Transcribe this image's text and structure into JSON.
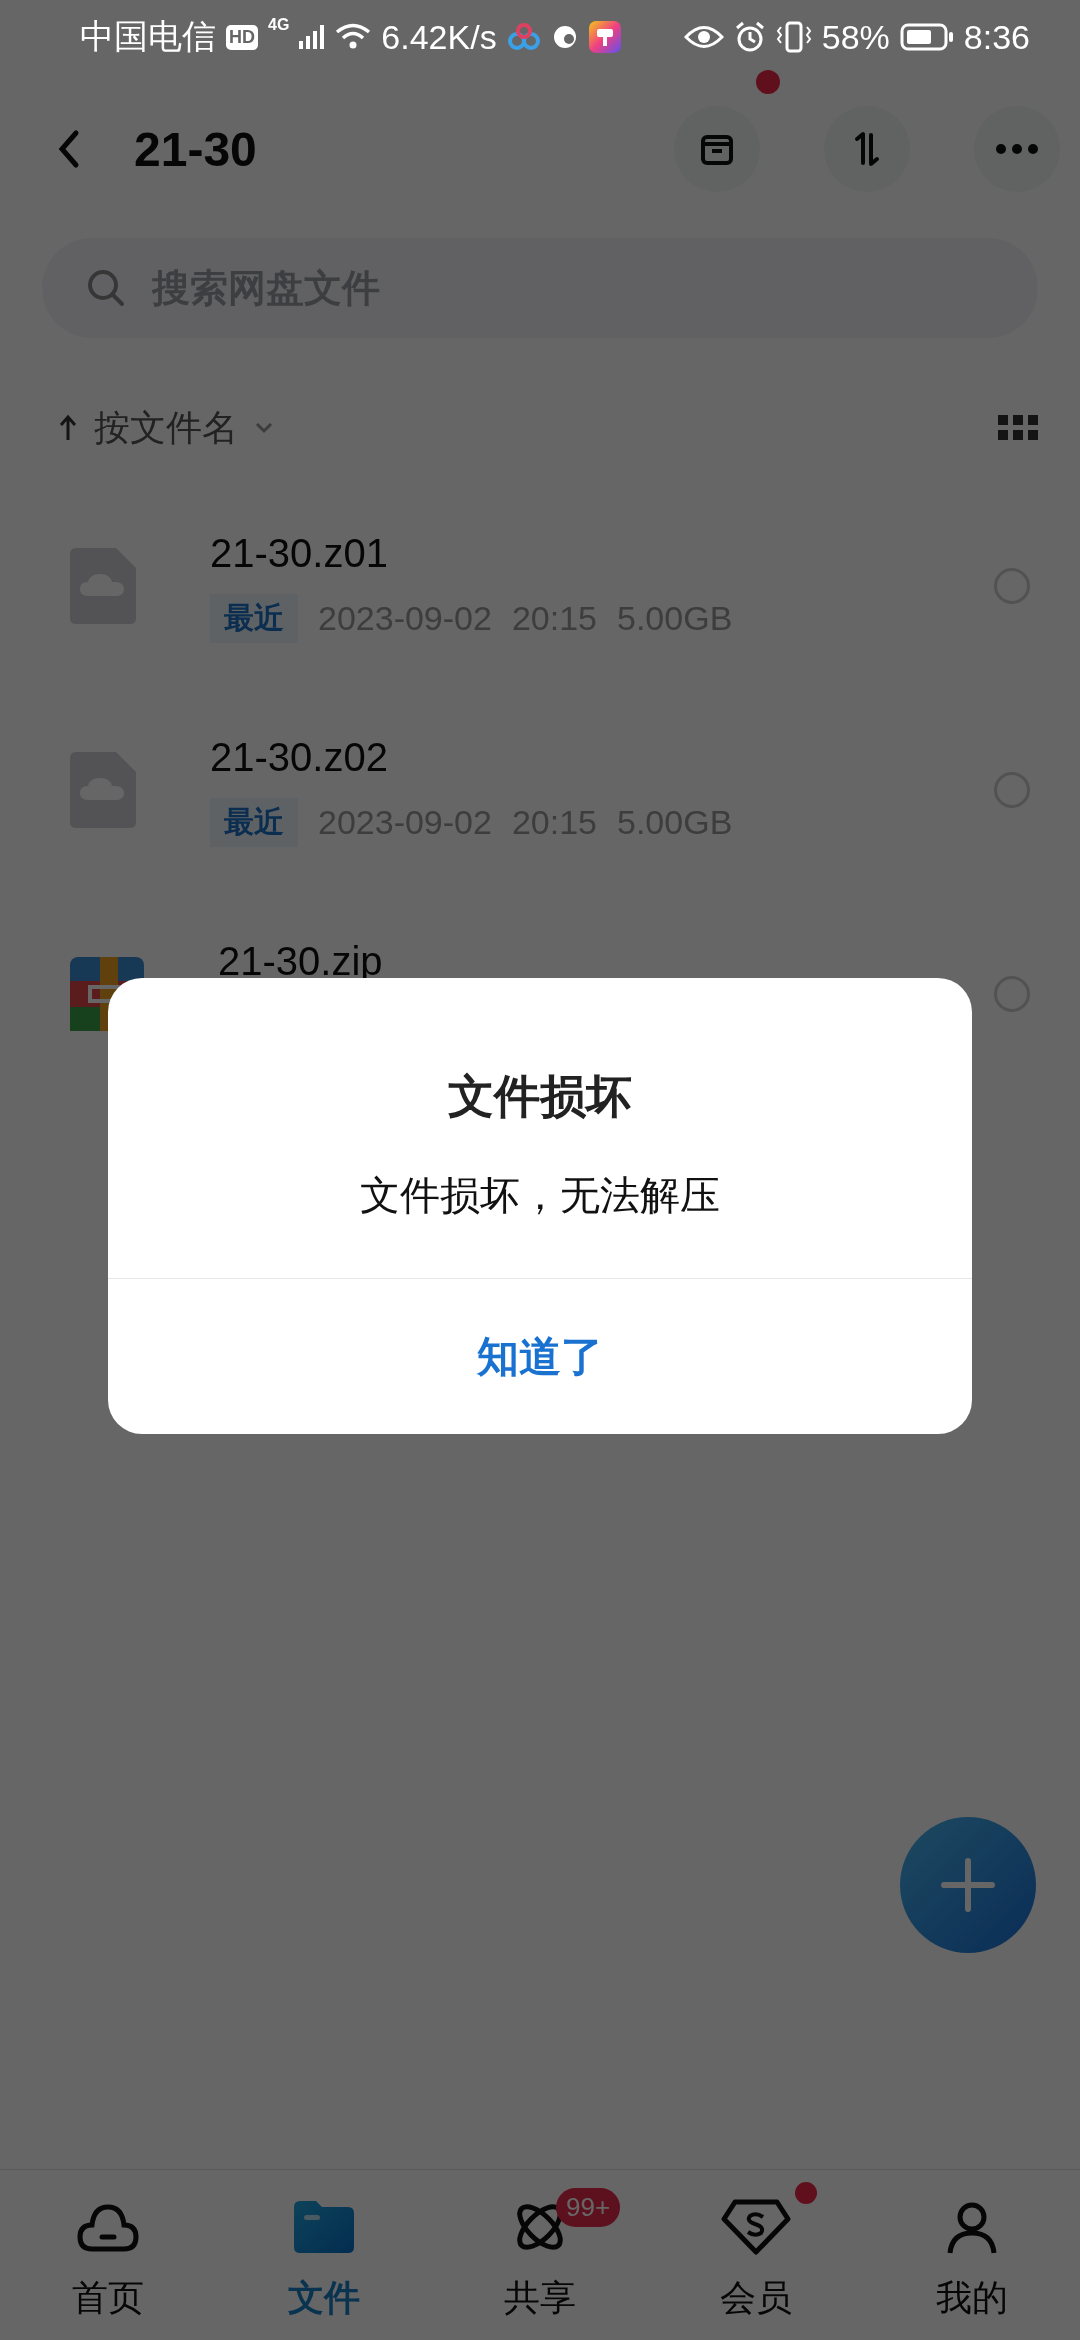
{
  "status_bar": {
    "carrier": "中国电信",
    "hd": "HD",
    "network": "4G",
    "speed": "6.42K/s",
    "battery": "58%",
    "time": "8:36"
  },
  "header": {
    "title": "21-30",
    "archive_badge": true
  },
  "search": {
    "placeholder": "搜索网盘文件"
  },
  "sort": {
    "label": "按文件名"
  },
  "files": [
    {
      "name": "21-30.z01",
      "kind": "cloud",
      "tag": "最近",
      "date": "2023-09-02",
      "time": "20:15",
      "size": "5.00GB",
      "selected": false
    },
    {
      "name": "21-30.z02",
      "kind": "cloud",
      "tag": "最近",
      "date": "2023-09-02",
      "time": "20:15",
      "size": "5.00GB",
      "selected": false
    },
    {
      "name": "21-30.zip",
      "kind": "archive",
      "selected": false
    }
  ],
  "dialog": {
    "title": "文件损坏",
    "message": "文件损坏，无法解压",
    "button": "知道了"
  },
  "tabs": [
    {
      "label": "首页",
      "selected": false
    },
    {
      "label": "文件",
      "selected": true
    },
    {
      "label": "共享",
      "selected": false,
      "badge": "99+"
    },
    {
      "label": "会员",
      "selected": false,
      "dot": true
    },
    {
      "label": "我的",
      "selected": false
    }
  ]
}
